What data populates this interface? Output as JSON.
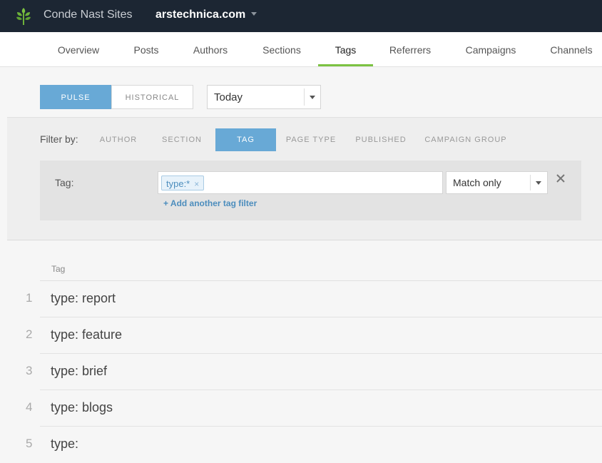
{
  "header": {
    "org_name": "Conde Nast Sites",
    "site_name": "arstechnica.com",
    "logo_icon": "parsley-leaf-icon",
    "brand_color": "#7cc242"
  },
  "nav": {
    "tabs": [
      {
        "label": "Overview"
      },
      {
        "label": "Posts"
      },
      {
        "label": "Authors"
      },
      {
        "label": "Sections"
      },
      {
        "label": "Tags",
        "active": true
      },
      {
        "label": "Referrers"
      },
      {
        "label": "Campaigns"
      },
      {
        "label": "Channels"
      }
    ]
  },
  "mode": {
    "pulse_label": "PULSE",
    "historical_label": "HISTORICAL",
    "active": "PULSE"
  },
  "date_select": {
    "value": "Today"
  },
  "filter": {
    "label": "Filter by:",
    "options": [
      {
        "label": "AUTHOR"
      },
      {
        "label": "SECTION"
      },
      {
        "label": "TAG",
        "active": true
      },
      {
        "label": "PAGE TYPE"
      },
      {
        "label": "PUBLISHED"
      },
      {
        "label": "CAMPAIGN GROUP"
      }
    ],
    "tag_row": {
      "label": "Tag:",
      "chip_value": "type:*",
      "chip_remove": "×",
      "add_link": "+ Add another tag filter",
      "match_value": "Match only"
    }
  },
  "table": {
    "header": "Tag",
    "rows": [
      {
        "rank": "1",
        "tag": "type: report"
      },
      {
        "rank": "2",
        "tag": "type: feature"
      },
      {
        "rank": "3",
        "tag": "type: brief"
      },
      {
        "rank": "4",
        "tag": "type: blogs"
      },
      {
        "rank": "5",
        "tag": "type:"
      }
    ]
  },
  "colors": {
    "topbar": "#1c2633",
    "accent_blue": "#68a9d6",
    "active_tab_underline": "#7cc242"
  }
}
